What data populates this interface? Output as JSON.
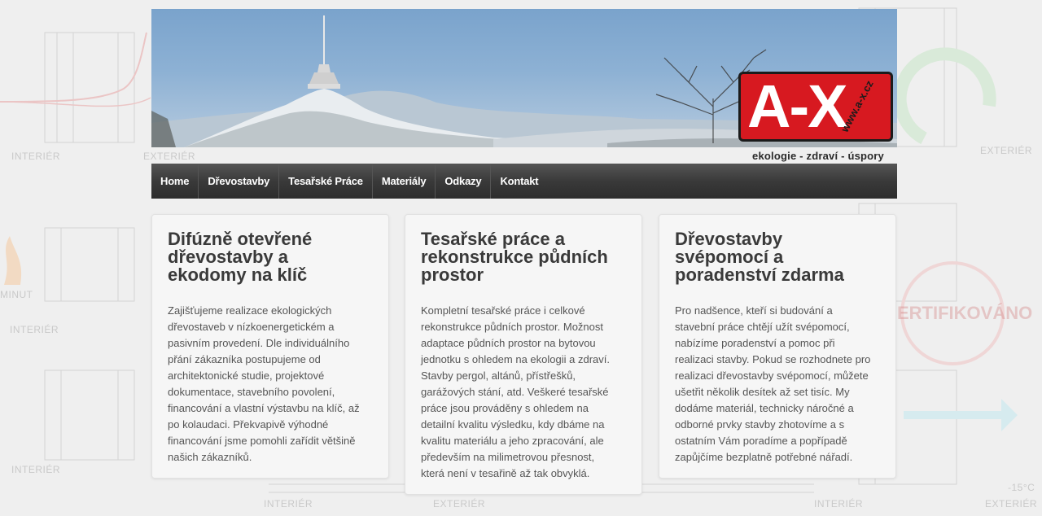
{
  "background": {
    "labels": {
      "interier": "INTERIÉR",
      "exterier": "EXTERIÉR",
      "minut": "MINUT",
      "certifikovano": "ERTIFIKOVÁNO",
      "temperature": "-15°C"
    }
  },
  "header": {
    "logo_text": "A-X",
    "logo_url": "www.a-x.cz",
    "tagline": "ekologie - zdraví - úspory"
  },
  "nav": {
    "items": [
      {
        "label": "Home"
      },
      {
        "label": "Dřevostavby"
      },
      {
        "label": "Tesařské Práce"
      },
      {
        "label": "Materiály"
      },
      {
        "label": "Odkazy"
      },
      {
        "label": "Kontakt"
      }
    ]
  },
  "cards": [
    {
      "title_lines": [
        "Difúzně otevřené",
        "dřevostavby a",
        "ekodomy na klíč"
      ],
      "body_lines": [
        "Zajišťujeme realizace ekologických",
        "dřevostaveb v nízkoenergetickém a",
        "pasivním provedení. Dle individuálního",
        "přání zákazníka postupujeme od",
        "architektonické studie, projektové",
        "dokumentace, stavebního povolení,",
        "financování a vlastní výstavbu na klíč, až",
        "po kolaudaci. Překvapivě výhodné",
        "financování jsme pomohli zařídit většině",
        "našich zákazníků."
      ]
    },
    {
      "title_lines": [
        "Tesařské práce a",
        "rekonstrukce půdních",
        "prostor"
      ],
      "body_lines": [
        "Kompletní tesařské práce i celkové",
        "rekonstrukce půdních prostor. Možnost",
        "adaptace půdních prostor na bytovou",
        "jednotku s ohledem na ekologii a zdraví.",
        "Stavby pergol, altánů, přístřešků,",
        "garážových stání, atd. Veškeré tesařské",
        "práce jsou prováděny s ohledem na",
        "detailní kvalitu výsledku, kdy dbáme na",
        "kvalitu materiálu a jeho zpracování, ale",
        "především na milimetrovou přesnost,",
        "která není v tesařině až tak obvyklá."
      ]
    },
    {
      "title_lines": [
        "Dřevostavby",
        "svépomocí a",
        "poradenství zdarma"
      ],
      "body_lines": [
        "Pro nadšence, kteří si budování a",
        "stavební práce chtějí užít svépomocí,",
        "nabízíme poradenství a pomoc při",
        "realizaci stavby. Pokud se rozhodnete pro",
        "realizaci dřevostavby svépomocí, můžete",
        "ušetřit několik desítek až set tisíc. My",
        "dodáme materiál, technicky náročné a",
        "odborné prvky stavby zhotovíme a s",
        "ostatním Vám poradíme a popřípadě",
        "zapůjčíme bezplatně potřebné nářadí."
      ]
    }
  ]
}
